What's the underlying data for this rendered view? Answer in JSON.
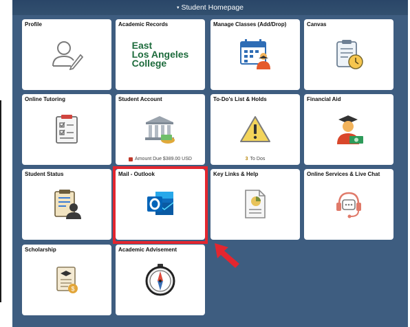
{
  "header": {
    "title": "Student Homepage",
    "caret": "▾"
  },
  "tiles": [
    {
      "title": "Profile",
      "icon": "user-edit-icon"
    },
    {
      "title": "Academic Records",
      "icon": "college-logo",
      "logo_lines": [
        "East",
        "Los Angeles",
        "College"
      ]
    },
    {
      "title": "Manage Classes (Add/Drop)",
      "icon": "calendar-person-icon"
    },
    {
      "title": "Canvas",
      "icon": "clipboard-clock-icon"
    },
    {
      "title": "Online Tutoring",
      "icon": "checklist-icon"
    },
    {
      "title": "Student Account",
      "icon": "bank-money-icon",
      "footer": "Amount Due $389.00 USD"
    },
    {
      "title": "To-Do's List & Holds",
      "icon": "warning-icon",
      "footer_count": "3",
      "footer": "To Dos"
    },
    {
      "title": "Financial Aid",
      "icon": "graduate-money-icon"
    },
    {
      "title": "Student Status",
      "icon": "person-document-icon"
    },
    {
      "title": "Mail - Outlook",
      "icon": "outlook-icon"
    },
    {
      "title": "Key Links & Help",
      "icon": "document-chart-icon"
    },
    {
      "title": "Online Services & Live Chat",
      "icon": "headset-chat-icon"
    },
    {
      "title": "Scholarship",
      "icon": "scroll-grad-icon"
    },
    {
      "title": "Academic Advisement",
      "icon": "compass-icon"
    }
  ],
  "colors": {
    "frame": "#3e5d80",
    "highlight": "#e3262f",
    "college_green": "#1d6b3c",
    "outlook_blue": "#0f6cbd"
  }
}
